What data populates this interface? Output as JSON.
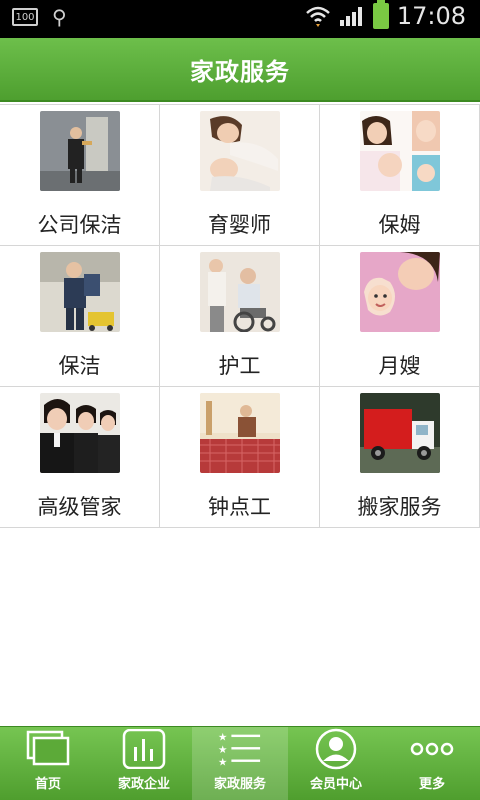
{
  "status_bar": {
    "battery_small": "100",
    "time": "17:08"
  },
  "header": {
    "title": "家政服务"
  },
  "services": [
    {
      "label": "公司保洁",
      "icon": "office-cleaning-photo"
    },
    {
      "label": "育婴师",
      "icon": "nursery-teacher-photo"
    },
    {
      "label": "保姆",
      "icon": "nanny-photo"
    },
    {
      "label": "保洁",
      "icon": "cleaner-photo"
    },
    {
      "label": "护工",
      "icon": "caregiver-photo"
    },
    {
      "label": "月嫂",
      "icon": "maternity-matron-photo"
    },
    {
      "label": "高级管家",
      "icon": "butler-photo"
    },
    {
      "label": "钟点工",
      "icon": "hourly-worker-photo"
    },
    {
      "label": "搬家服务",
      "icon": "moving-truck-photo"
    }
  ],
  "tabs": [
    {
      "label": "首页",
      "icon": "home-icon"
    },
    {
      "label": "家政企业",
      "icon": "company-chart-icon"
    },
    {
      "label": "家政服务",
      "icon": "service-list-icon",
      "active": true
    },
    {
      "label": "会员中心",
      "icon": "member-avatar-icon"
    },
    {
      "label": "更多",
      "icon": "more-dots-icon"
    }
  ],
  "colors": {
    "accent_green": "#5aaa38",
    "border": "#d6d6d6"
  }
}
